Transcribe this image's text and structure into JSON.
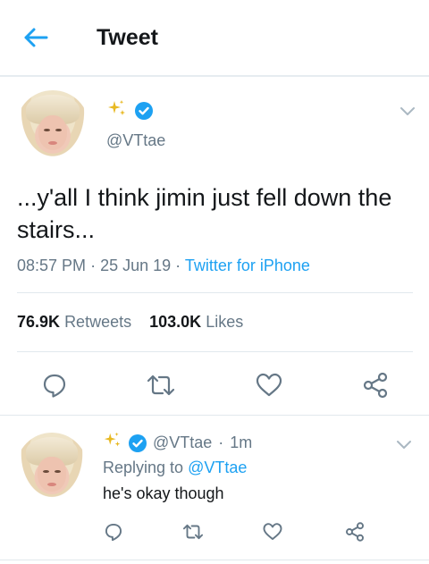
{
  "header": {
    "title": "Tweet",
    "back_icon": "arrow-left-icon"
  },
  "main_tweet": {
    "display_name_icons": [
      "sparkles-icon",
      "verified-badge-icon"
    ],
    "handle": "@VTtae",
    "text": "...y'all I think jimin just fell down the stairs...",
    "time": "08:57 PM",
    "date": "25 Jun 19",
    "meta_sep": "·",
    "source": "Twitter for iPhone",
    "retweets_count": "76.9K",
    "retweets_label": "Retweets",
    "likes_count": "103.0K",
    "likes_label": "Likes",
    "actions": [
      "reply-icon",
      "retweet-icon",
      "like-icon",
      "share-icon"
    ]
  },
  "reply_tweet": {
    "handle": "@VTtae",
    "time_sep": "·",
    "time_ago": "1m",
    "replying_label": "Replying to",
    "replying_to": "@VTtae",
    "text": "he's okay though",
    "actions": [
      "reply-icon",
      "retweet-icon",
      "like-icon",
      "share-icon"
    ]
  },
  "colors": {
    "accent": "#1da1f2",
    "secondary_text": "#657786",
    "sparkle": "#e1b82a",
    "divider": "#e1e8ed"
  }
}
